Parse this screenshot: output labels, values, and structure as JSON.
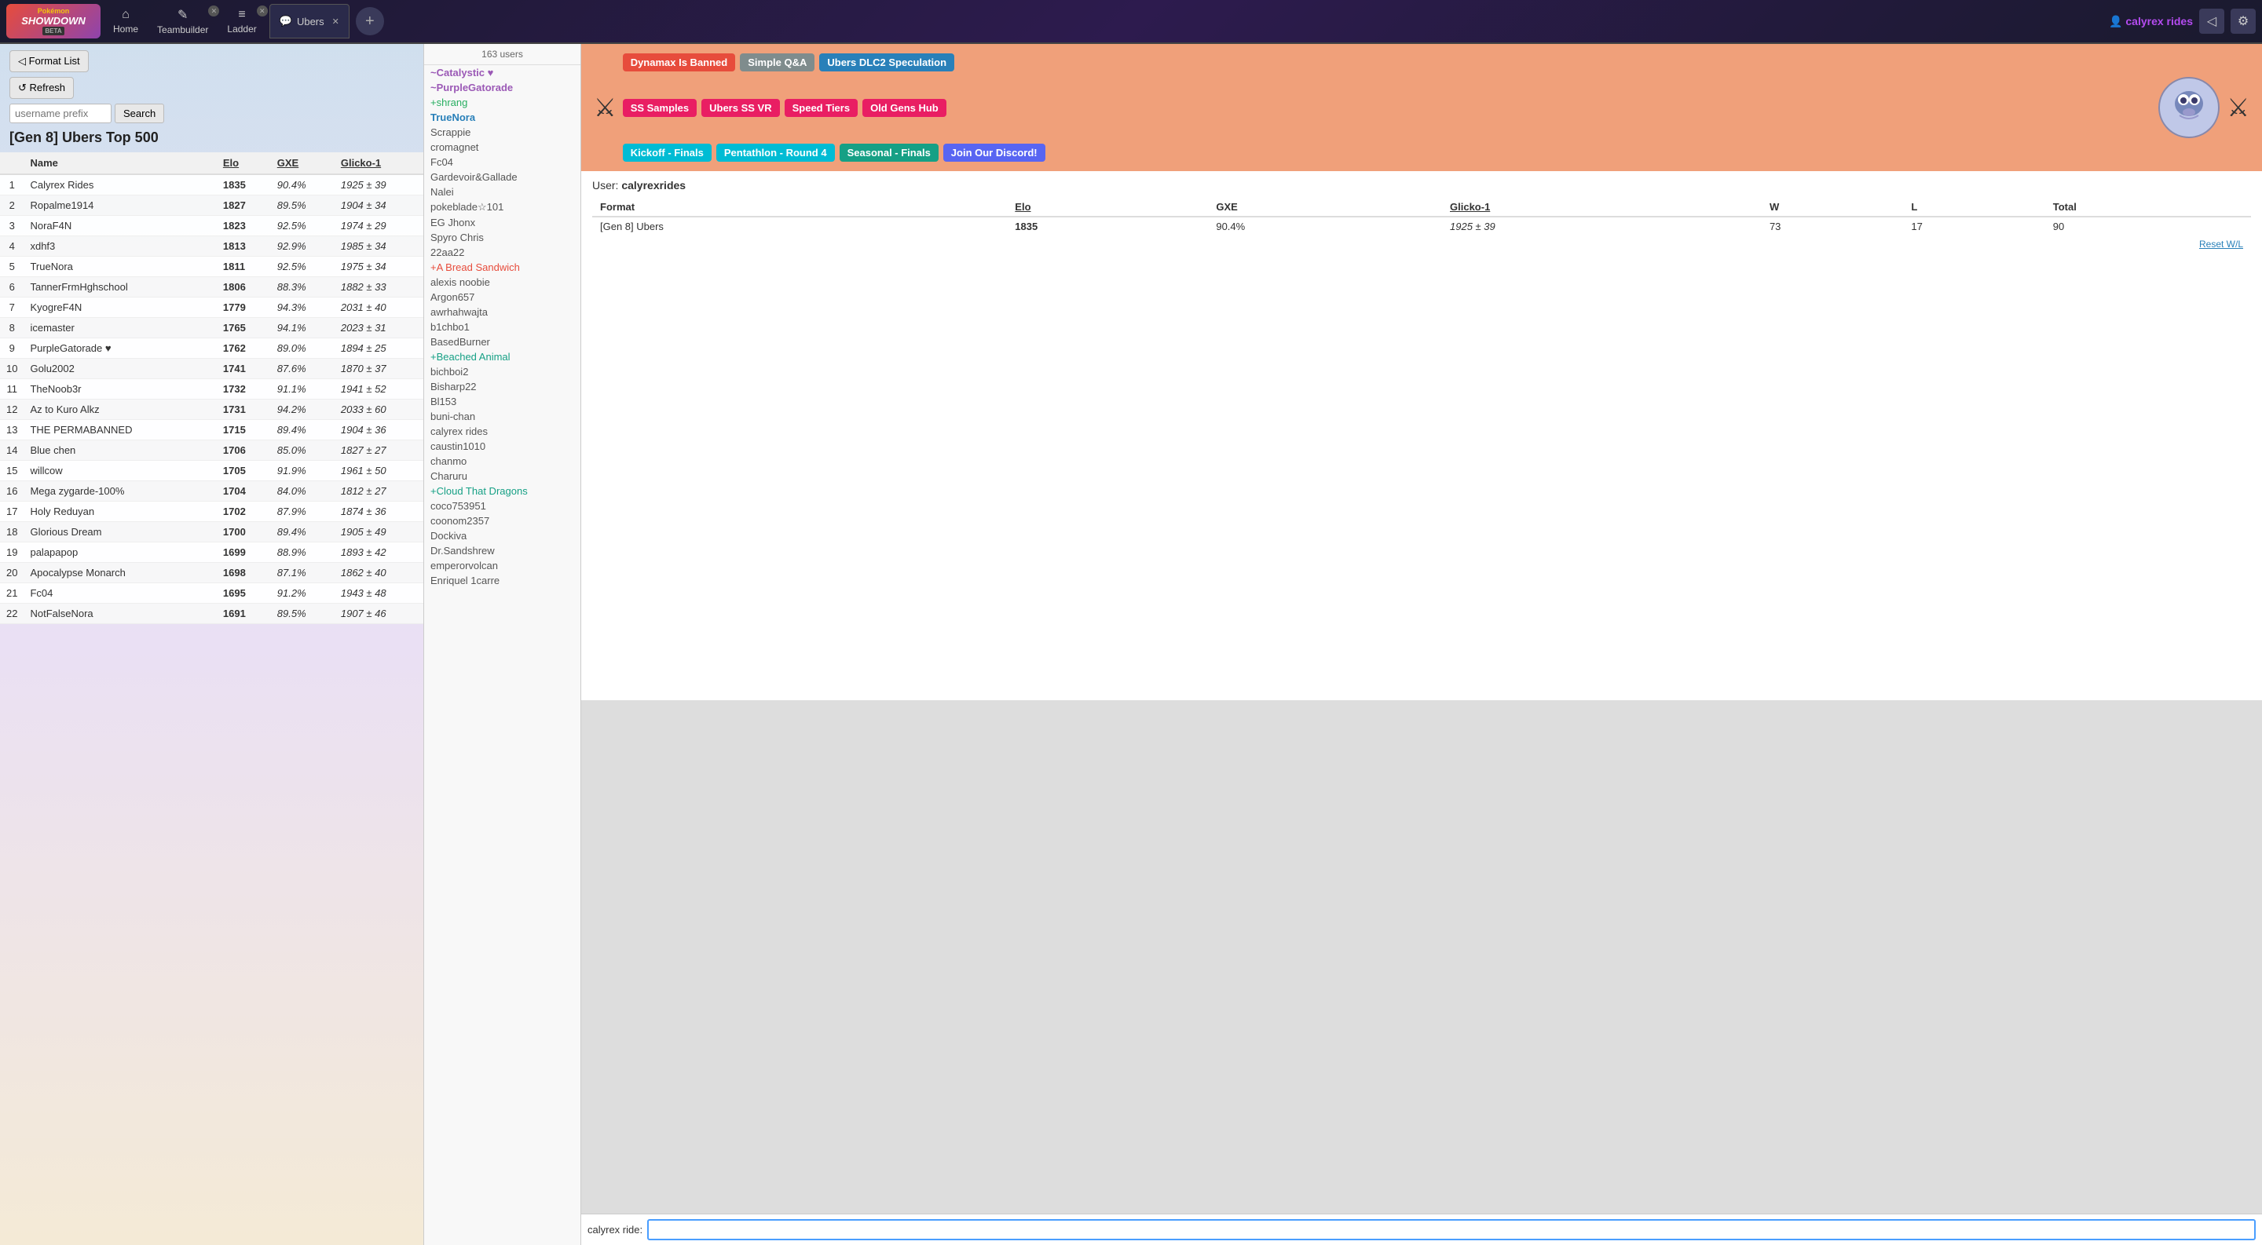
{
  "nav": {
    "logo": {
      "pokemon": "Pokémon",
      "showdown": "SHOWDOWN",
      "beta": "BETA"
    },
    "tabs": [
      {
        "label": "Home",
        "icon": "⌂"
      },
      {
        "label": "Teambuilder",
        "icon": "✎"
      },
      {
        "label": "Ladder",
        "icon": "≡"
      }
    ],
    "active_room": "Ubers",
    "add_tab": "+",
    "username": "calyrex rides",
    "user_icon": "👤"
  },
  "ladder": {
    "format_list_btn": "◁ Format List",
    "refresh_btn": "↺ Refresh",
    "search_placeholder": "username prefix",
    "search_btn": "Search",
    "title": "[Gen 8] Ubers Top 500",
    "columns": [
      "",
      "Name",
      "Elo",
      "GXE",
      "Glicko-1"
    ],
    "rows": [
      {
        "rank": 1,
        "name": "Calyrex Rides",
        "elo": "1835",
        "gxe": "90.4%",
        "glicko": "1925 ± 39"
      },
      {
        "rank": 2,
        "name": "Ropalme1914",
        "elo": "1827",
        "gxe": "89.5%",
        "glicko": "1904 ± 34"
      },
      {
        "rank": 3,
        "name": "NoraF4N",
        "elo": "1823",
        "gxe": "92.5%",
        "glicko": "1974 ± 29"
      },
      {
        "rank": 4,
        "name": "xdhf3",
        "elo": "1813",
        "gxe": "92.9%",
        "glicko": "1985 ± 34"
      },
      {
        "rank": 5,
        "name": "TrueNora",
        "elo": "1811",
        "gxe": "92.5%",
        "glicko": "1975 ± 34"
      },
      {
        "rank": 6,
        "name": "TannerFrmHghschool",
        "elo": "1806",
        "gxe": "88.3%",
        "glicko": "1882 ± 33"
      },
      {
        "rank": 7,
        "name": "KyogreF4N",
        "elo": "1779",
        "gxe": "94.3%",
        "glicko": "2031 ± 40"
      },
      {
        "rank": 8,
        "name": "icemaster",
        "elo": "1765",
        "gxe": "94.1%",
        "glicko": "2023 ± 31"
      },
      {
        "rank": 9,
        "name": "PurpleGatorade ♥",
        "elo": "1762",
        "gxe": "89.0%",
        "glicko": "1894 ± 25"
      },
      {
        "rank": 10,
        "name": "Golu2002",
        "elo": "1741",
        "gxe": "87.6%",
        "glicko": "1870 ± 37"
      },
      {
        "rank": 11,
        "name": "TheNoob3r",
        "elo": "1732",
        "gxe": "91.1%",
        "glicko": "1941 ± 52"
      },
      {
        "rank": 12,
        "name": "Az to Kuro Alkz",
        "elo": "1731",
        "gxe": "94.2%",
        "glicko": "2033 ± 60"
      },
      {
        "rank": 13,
        "name": "THE PERMABANNED",
        "elo": "1715",
        "gxe": "89.4%",
        "glicko": "1904 ± 36"
      },
      {
        "rank": 14,
        "name": "Blue chen",
        "elo": "1706",
        "gxe": "85.0%",
        "glicko": "1827 ± 27"
      },
      {
        "rank": 15,
        "name": "willcow",
        "elo": "1705",
        "gxe": "91.9%",
        "glicko": "1961 ± 50"
      },
      {
        "rank": 16,
        "name": "Mega zygarde-100%",
        "elo": "1704",
        "gxe": "84.0%",
        "glicko": "1812 ± 27"
      },
      {
        "rank": 17,
        "name": "Holy Reduyan",
        "elo": "1702",
        "gxe": "87.9%",
        "glicko": "1874 ± 36"
      },
      {
        "rank": 18,
        "name": "Glorious Dream",
        "elo": "1700",
        "gxe": "89.4%",
        "glicko": "1905 ± 49"
      },
      {
        "rank": 19,
        "name": "palapapop",
        "elo": "1699",
        "gxe": "88.9%",
        "glicko": "1893 ± 42"
      },
      {
        "rank": 20,
        "name": "Apocalypse Monarch",
        "elo": "1698",
        "gxe": "87.1%",
        "glicko": "1862 ± 40"
      },
      {
        "rank": 21,
        "name": "Fc04",
        "elo": "1695",
        "gxe": "91.2%",
        "glicko": "1943 ± 48"
      },
      {
        "rank": 22,
        "name": "NotFalseNora",
        "elo": "1691",
        "gxe": "89.5%",
        "glicko": "1907 ± 46"
      }
    ]
  },
  "chat": {
    "user_count": "163 users",
    "users": [
      {
        "name": "Catalystic ♥",
        "type": "staff"
      },
      {
        "name": "PurpleGatorade",
        "type": "staff"
      },
      {
        "name": "shrang",
        "type": "voice"
      },
      {
        "name": "TrueNora",
        "type": "highlight"
      },
      {
        "name": "Scrappie",
        "type": "normal"
      },
      {
        "name": "cromagnet",
        "type": "normal"
      },
      {
        "name": "Fc04",
        "type": "normal"
      },
      {
        "name": "Gardevoir&Gallade",
        "type": "normal"
      },
      {
        "name": "Nalei",
        "type": "normal"
      },
      {
        "name": "pokeblade☆101",
        "type": "normal"
      },
      {
        "name": "EG Jhonx",
        "type": "normal"
      },
      {
        "name": "Spyro Chris",
        "type": "normal"
      },
      {
        "name": "22aa22",
        "type": "normal"
      },
      {
        "name": "A Bread Sandwich",
        "type": "red"
      },
      {
        "name": "alexis noobie",
        "type": "normal"
      },
      {
        "name": "Argon657",
        "type": "normal"
      },
      {
        "name": "awrhahwajta",
        "type": "normal"
      },
      {
        "name": "b1chbo1",
        "type": "normal"
      },
      {
        "name": "BasedBurner",
        "type": "normal"
      },
      {
        "name": "Beached Animal",
        "type": "teal"
      },
      {
        "name": "bichboi2",
        "type": "normal"
      },
      {
        "name": "Bisharp22",
        "type": "normal"
      },
      {
        "name": "Bl153",
        "type": "normal"
      },
      {
        "name": "buni-chan",
        "type": "normal"
      },
      {
        "name": "calyrex rides",
        "type": "normal"
      },
      {
        "name": "caustin1010",
        "type": "normal"
      },
      {
        "name": "chanmo",
        "type": "normal"
      },
      {
        "name": "Charuru",
        "type": "normal"
      },
      {
        "name": "Cloud That Dragons",
        "type": "teal"
      },
      {
        "name": "coco753951",
        "type": "normal"
      },
      {
        "name": "coonom2357",
        "type": "normal"
      },
      {
        "name": "Dockiva",
        "type": "normal"
      },
      {
        "name": "Dr.Sandshrew",
        "type": "normal"
      },
      {
        "name": "emperorvolcan",
        "type": "normal"
      },
      {
        "name": "Enriquel 1carre",
        "type": "normal"
      }
    ]
  },
  "room": {
    "title": "Ubers",
    "links_row1": [
      {
        "label": "Dynamax Is Banned",
        "color": "red"
      },
      {
        "label": "Simple Q&A",
        "color": "gray"
      },
      {
        "label": "Ubers DLC2 Speculation",
        "color": "blue"
      }
    ],
    "links_row2": [
      {
        "label": "SS Samples",
        "color": "pink"
      },
      {
        "label": "Ubers SS VR",
        "color": "pink"
      },
      {
        "label": "Speed Tiers",
        "color": "pink"
      },
      {
        "label": "Old Gens Hub",
        "color": "pink"
      }
    ],
    "links_row3": [
      {
        "label": "Kickoff - Finals",
        "color": "cyan"
      },
      {
        "label": "Pentathlon - Round 4",
        "color": "cyan"
      },
      {
        "label": "Seasonal - Finals",
        "color": "teal"
      }
    ],
    "links_row4": [
      {
        "label": "Join Our Discord!",
        "color": "discord"
      }
    ]
  },
  "user_stats": {
    "label": "User:",
    "username": "calyrexrides",
    "columns": [
      "Format",
      "Elo",
      "GXE",
      "Glicko-1",
      "W",
      "L",
      "Total"
    ],
    "row": {
      "format": "[Gen 8] Ubers",
      "elo": "1835",
      "gxe": "90.4%",
      "glicko": "1925 ± 39",
      "w": "73",
      "l": "17",
      "total": "90"
    },
    "reset_wl": "Reset W/L"
  },
  "chat_input": {
    "label": "calyrex ride:",
    "placeholder": ""
  }
}
